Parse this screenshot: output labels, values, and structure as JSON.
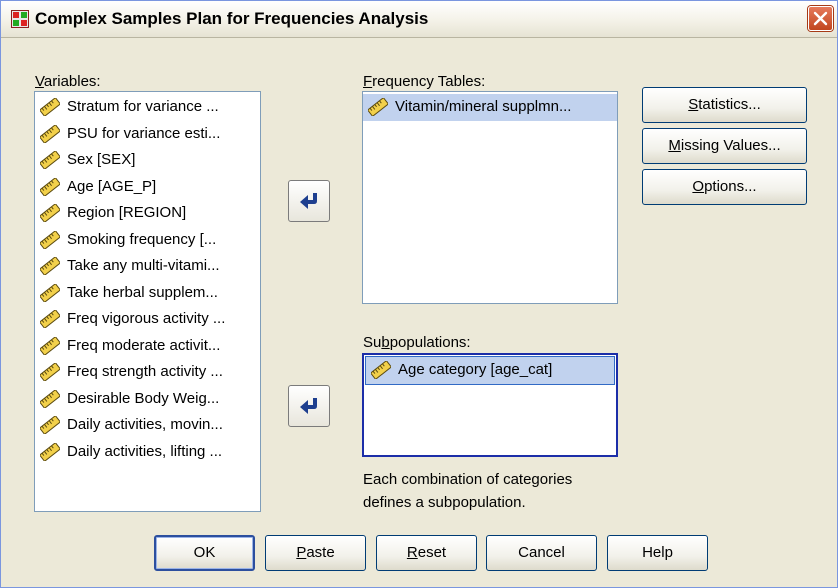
{
  "window": {
    "title": "Complex Samples Plan for Frequencies Analysis"
  },
  "variables": {
    "label_mnemonic": "V",
    "label_rest": "ariables:",
    "items": [
      "Stratum for variance ...",
      "PSU for variance esti...",
      "Sex [SEX]",
      "Age [AGE_P]",
      "Region [REGION]",
      "Smoking frequency [...",
      "Take any multi-vitami...",
      "Take herbal supplem...",
      "Freq vigorous activity ...",
      "Freq moderate activit...",
      "Freq strength activity ...",
      "Desirable Body Weig...",
      "Daily activities, movin...",
      "Daily activities, lifting ..."
    ]
  },
  "frequency_tables": {
    "label_mnemonic": "F",
    "label_rest": "requency Tables:",
    "items": [
      "Vitamin/mineral supplmn..."
    ]
  },
  "subpopulations": {
    "label_pre": "Su",
    "label_mnemonic": "b",
    "label_rest": "populations:",
    "items": [
      "Age category [age_cat]"
    ]
  },
  "note": {
    "line1": "Each combination of categories",
    "line2": "defines a subpopulation."
  },
  "side_buttons": {
    "statistics": {
      "mnemonic": "S",
      "rest": "tatistics..."
    },
    "missing_values": {
      "mnemonic": "M",
      "rest": "issing Values..."
    },
    "options": {
      "mnemonic": "O",
      "rest": "ptions..."
    }
  },
  "bottom_buttons": {
    "ok": "OK",
    "paste": {
      "mnemonic": "P",
      "rest": "aste"
    },
    "reset": {
      "mnemonic": "R",
      "rest": "eset"
    },
    "cancel": "Cancel",
    "help": "Help"
  },
  "icons": {
    "title": "spss-app-icon",
    "close": "close-icon",
    "variable": "ruler-scale-icon",
    "move": "move-arrow-icon"
  },
  "colors": {
    "dialog_bg": "#ece9d8",
    "selection": "#c1d2ee",
    "focus_border": "#1c2ea8",
    "close_red": "#c1461e"
  }
}
